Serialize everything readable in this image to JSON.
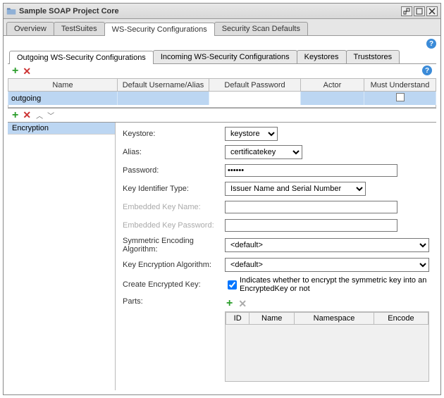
{
  "titlebar": {
    "title": "Sample SOAP Project Core"
  },
  "main_tabs": [
    "Overview",
    "TestSuites",
    "WS-Security Configurations",
    "Security Scan Defaults"
  ],
  "main_tab_active": 2,
  "ws_tabs": [
    "Outgoing WS-Security Configurations",
    "Incoming WS-Security Configurations",
    "Keystores",
    "Truststores"
  ],
  "ws_tab_active": 0,
  "outgoing_table": {
    "headers": [
      "Name",
      "Default Username/Alias",
      "Default Password",
      "Actor",
      "Must Understand"
    ],
    "rows": [
      {
        "name": "outgoing",
        "alias": "",
        "password": "",
        "actor": "",
        "must_understand": false
      }
    ]
  },
  "entries_list": [
    "Encryption"
  ],
  "form": {
    "labels": {
      "keystore": "Keystore:",
      "alias": "Alias:",
      "password": "Password:",
      "key_identifier_type": "Key Identifier Type:",
      "embedded_key_name": "Embedded Key Name:",
      "embedded_key_password": "Embedded Key Password:",
      "sym_enc_algo": "Symmetric Encoding Algorithm:",
      "key_enc_algo": "Key Encryption Algorithm:",
      "create_enc_key": "Create Encrypted Key:",
      "parts": "Parts:"
    },
    "values": {
      "keystore": "keystore",
      "alias": "certificatekey",
      "password": "••••••",
      "key_identifier_type": "Issuer Name and Serial Number",
      "embedded_key_name": "",
      "embedded_key_password": "",
      "sym_enc_algo": "<default>",
      "key_enc_algo": "<default>",
      "create_enc_key": true,
      "create_enc_key_desc": "Indicates whether to encrypt the symmetric key into an EncryptedKey or not"
    },
    "parts_headers": [
      "ID",
      "Name",
      "Namespace",
      "Encode"
    ]
  }
}
